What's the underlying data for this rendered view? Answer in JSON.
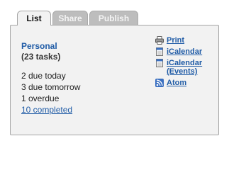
{
  "tabs": [
    {
      "label": "List"
    },
    {
      "label": "Share"
    },
    {
      "label": "Publish"
    }
  ],
  "list": {
    "name": "Personal",
    "task_count": "(23 tasks)",
    "stats": [
      "2 due today",
      "3 due tomorrow",
      "1 overdue"
    ],
    "completed_link": "10 completed"
  },
  "links": [
    {
      "label": "Print",
      "icon": "printer-icon"
    },
    {
      "label": "iCalendar",
      "icon": "calendar-icon"
    },
    {
      "label_line1": "iCalendar",
      "label_line2": "(Events)",
      "icon": "calendar-icon"
    },
    {
      "label": "Atom",
      "icon": "feed-icon"
    }
  ],
  "colors": {
    "link_blue": "#1f5ba6",
    "panel_bg": "#f2f2f2",
    "inactive_tab": "#bdbdbd",
    "feed_blue": "#3a6fc0"
  }
}
